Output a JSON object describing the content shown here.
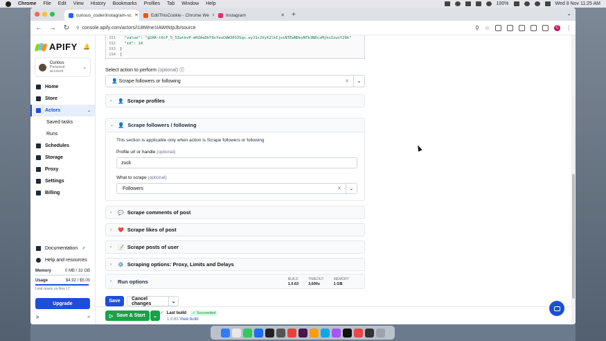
{
  "menubar": {
    "items": [
      "Chrome",
      "File",
      "Edit",
      "View",
      "History",
      "Bookmarks",
      "Profiles",
      "Tab",
      "Window",
      "Help"
    ],
    "battery": "100%",
    "clock": "Wed 8 Nov  11:25 AM"
  },
  "tabs": [
    {
      "title": "curious_coder/instagram-sc",
      "favicon_color": "#2563eb"
    },
    {
      "title": "EditThisCookie - Chrome We",
      "favicon_color": "#ea580c"
    },
    {
      "title": "Instagram",
      "favicon_color": "#e1306c"
    }
  ],
  "address_bar": {
    "url": "console.apify.com/actors/I18tWne1lAWtNIpJb/source"
  },
  "sidebar": {
    "logo": "APIFY",
    "user": {
      "name": "Curious",
      "plan": "Personal account"
    },
    "nav": [
      {
        "label": "Home"
      },
      {
        "label": "Store"
      },
      {
        "label": "Actors"
      },
      {
        "label": "Saved tasks"
      },
      {
        "label": "Runs"
      },
      {
        "label": "Schedules"
      },
      {
        "label": "Storage"
      },
      {
        "label": "Proxy"
      },
      {
        "label": "Settings"
      },
      {
        "label": "Billing"
      }
    ],
    "links": [
      {
        "label": "Documentation"
      },
      {
        "label": "Help and resources"
      }
    ],
    "memory": {
      "label": "Memory",
      "value": "0 MB / 32 GB"
    },
    "usage": {
      "label": "Usage",
      "value": "$4.92 / $5.00",
      "fraction": 0.98
    },
    "limit_note": "Limit resets on Nov 17",
    "upgrade_label": "Upgrade"
  },
  "code": {
    "lines": [
      {
        "n": "191",
        "text": "  \"value\": \"@2AR-t6cF_5_5IwtkvP-mHZAeDbT0sYeuCWWJ0S3Sqc.eyJ1c2VyX2lkIjoiNTEwNDkyNTk3NDcxMjkxIiwiY29k\""
      },
      {
        "n": "192",
        "text": "  \"id\": 14"
      },
      {
        "n": "193",
        "text": "}"
      },
      {
        "n": "194",
        "text": "]"
      }
    ]
  },
  "action": {
    "label": "Select action to perform",
    "optional": "(optional)",
    "value": "👤 Scrape followers or following"
  },
  "sections": {
    "profiles": {
      "emoji": "👤",
      "title": "Scrape profiles"
    },
    "followers": {
      "emoji": "👤",
      "title": "Scrape followers / following",
      "note": "This section is applicable only when action is Scrape followers or following",
      "profile_label": "Profile url or handle",
      "profile_optional": "(optional)",
      "profile_value": "zuck",
      "what_label": "What to scrape",
      "what_optional": "(optional)",
      "what_value": "Followers"
    },
    "comments": {
      "emoji": "💬",
      "title": "Scrape comments of post"
    },
    "likes": {
      "emoji": "❤️",
      "title": "Scrape likes of post"
    },
    "posts": {
      "emoji": "📝",
      "title": "Scrape posts of user"
    },
    "scraping": {
      "emoji": "⚙️",
      "title": "Scraping options: Proxy, Limits and Delays"
    }
  },
  "run_options": {
    "title": "Run options",
    "build_label": "BUILD",
    "build_value": "1.0.63",
    "timeout_label": "TIMEOUT",
    "timeout_value": "3,600s",
    "memory_label": "MEMORY",
    "memory_value": "1 GB"
  },
  "actions": {
    "save": "Save",
    "cancel": "Cancel changes",
    "save_start": "Save & Start"
  },
  "last_build": {
    "label": "Last build",
    "status": "✓ Succeeded",
    "version": "1.0.63",
    "view_link": "View build"
  }
}
